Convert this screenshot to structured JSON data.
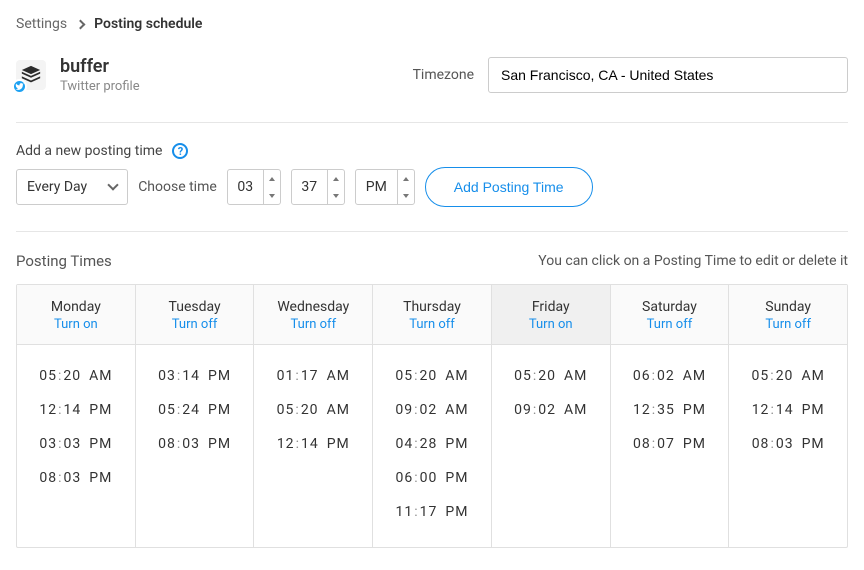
{
  "breadcrumb": {
    "parent": "Settings",
    "current": "Posting schedule"
  },
  "profile": {
    "name": "buffer",
    "sub": "Twitter profile"
  },
  "timezone": {
    "label": "Timezone",
    "value": "San Francisco, CA - United States"
  },
  "add": {
    "label": "Add a new posting time",
    "freq": "Every Day",
    "choose": "Choose time",
    "hour": "03",
    "minute": "37",
    "ampm": "PM",
    "button": "Add Posting Time"
  },
  "ptimes": {
    "label": "Posting Times",
    "hint": "You can click on a Posting Time to edit or delete it"
  },
  "days": [
    {
      "name": "Monday",
      "toggle": "Turn on",
      "highlighted": false,
      "times": [
        [
          "05",
          "20",
          "AM"
        ],
        [
          "12",
          "14",
          "PM"
        ],
        [
          "03",
          "03",
          "PM"
        ],
        [
          "08",
          "03",
          "PM"
        ]
      ]
    },
    {
      "name": "Tuesday",
      "toggle": "Turn off",
      "highlighted": false,
      "times": [
        [
          "03",
          "14",
          "PM"
        ],
        [
          "05",
          "24",
          "PM"
        ],
        [
          "08",
          "03",
          "PM"
        ]
      ]
    },
    {
      "name": "Wednesday",
      "toggle": "Turn off",
      "highlighted": false,
      "times": [
        [
          "01",
          "17",
          "AM"
        ],
        [
          "05",
          "20",
          "AM"
        ],
        [
          "12",
          "14",
          "PM"
        ]
      ]
    },
    {
      "name": "Thursday",
      "toggle": "Turn off",
      "highlighted": false,
      "times": [
        [
          "05",
          "20",
          "AM"
        ],
        [
          "09",
          "02",
          "AM"
        ],
        [
          "04",
          "28",
          "PM"
        ],
        [
          "06",
          "00",
          "PM"
        ],
        [
          "11",
          "17",
          "PM"
        ]
      ]
    },
    {
      "name": "Friday",
      "toggle": "Turn on",
      "highlighted": true,
      "times": [
        [
          "05",
          "20",
          "AM"
        ],
        [
          "09",
          "02",
          "AM"
        ]
      ]
    },
    {
      "name": "Saturday",
      "toggle": "Turn off",
      "highlighted": false,
      "times": [
        [
          "06",
          "02",
          "AM"
        ],
        [
          "12",
          "35",
          "PM"
        ],
        [
          "08",
          "07",
          "PM"
        ]
      ]
    },
    {
      "name": "Sunday",
      "toggle": "Turn off",
      "highlighted": false,
      "times": [
        [
          "05",
          "20",
          "AM"
        ],
        [
          "12",
          "14",
          "PM"
        ],
        [
          "08",
          "03",
          "PM"
        ]
      ]
    }
  ]
}
